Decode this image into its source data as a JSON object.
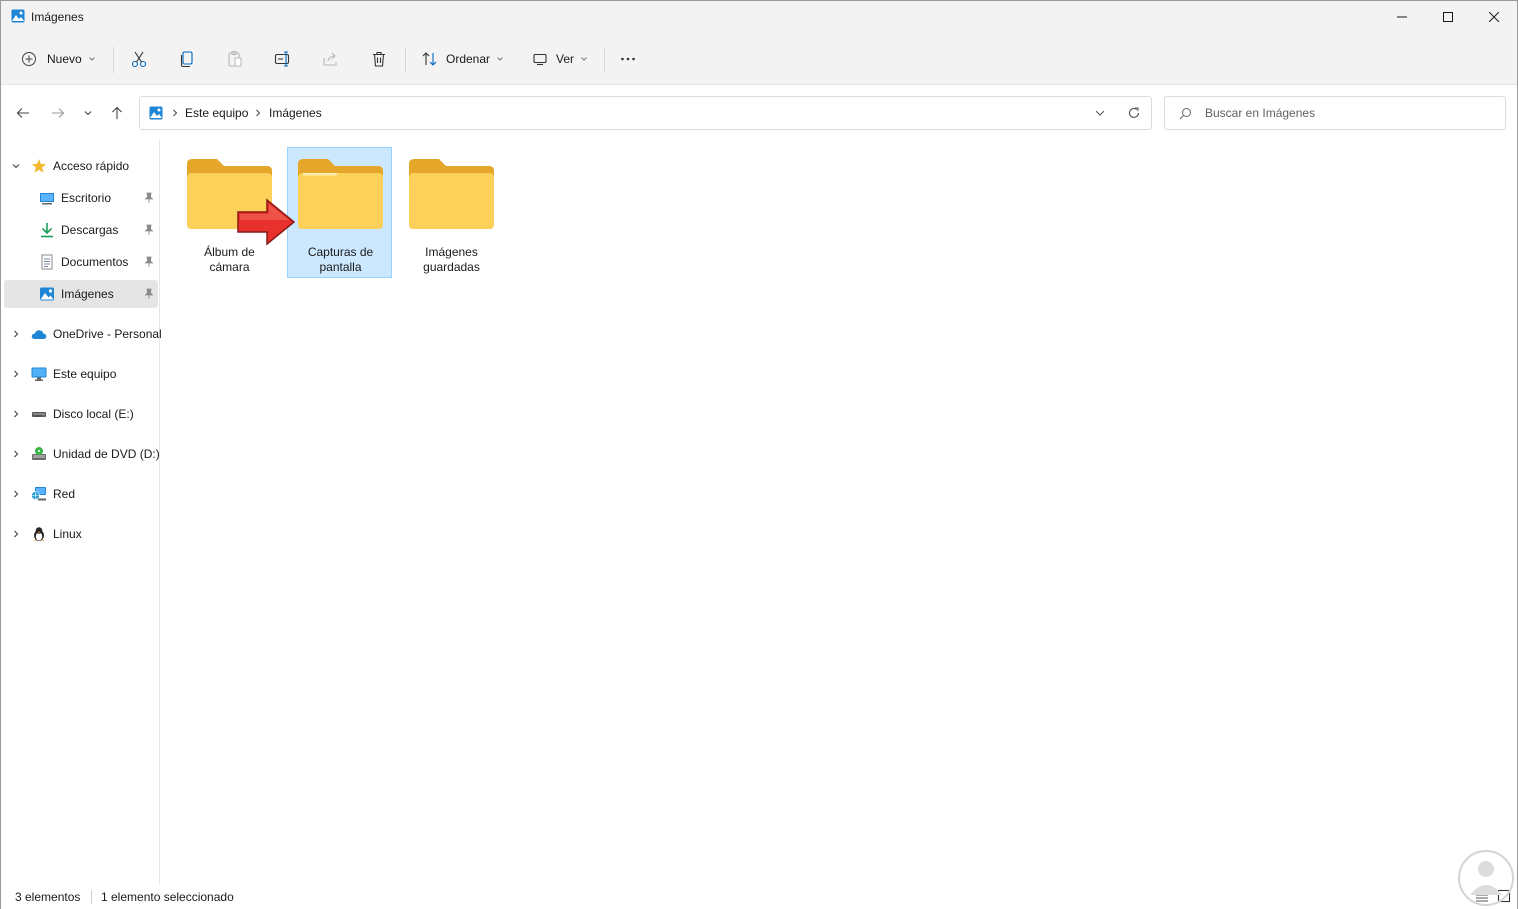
{
  "window": {
    "title": "Imágenes",
    "minimize_icon": "minimize-icon",
    "maximize_icon": "maximize-icon",
    "close_icon": "close-icon"
  },
  "toolbar": {
    "new_label": "Nuevo",
    "sort_label": "Ordenar",
    "view_label": "Ver",
    "icons": [
      "cut-icon",
      "copy-icon",
      "paste-icon",
      "rename-icon",
      "share-icon",
      "delete-icon",
      "more-icon"
    ]
  },
  "address": {
    "crumbs": [
      "Este equipo",
      "Imágenes"
    ],
    "search_placeholder": "Buscar en Imágenes"
  },
  "sidebar": {
    "items": [
      {
        "label": "Acceso rápido",
        "icon": "star-icon"
      },
      {
        "label": "Escritorio",
        "icon": "desktop-icon",
        "pinned": true
      },
      {
        "label": "Descargas",
        "icon": "download-icon",
        "pinned": true
      },
      {
        "label": "Documentos",
        "icon": "document-icon",
        "pinned": true
      },
      {
        "label": "Imágenes",
        "icon": "pictures-icon",
        "pinned": true,
        "active": true
      },
      {
        "label": "OneDrive - Personal",
        "icon": "cloud-icon"
      },
      {
        "label": "Este equipo",
        "icon": "computer-icon"
      },
      {
        "label": "Disco local (E:)",
        "icon": "drive-icon"
      },
      {
        "label": "Unidad de DVD (D:)",
        "icon": "dvd-icon"
      },
      {
        "label": "Red",
        "icon": "network-icon"
      },
      {
        "label": "Linux",
        "icon": "linux-icon"
      }
    ]
  },
  "folders": [
    {
      "line1": "Álbum de",
      "line2": "cámara",
      "selected": false
    },
    {
      "line1": "Capturas de",
      "line2": "pantalla",
      "selected": true
    },
    {
      "line1": "Imágenes",
      "line2": "guardadas",
      "selected": false
    }
  ],
  "status": {
    "count": "3 elementos",
    "selection": "1 elemento seleccionado"
  },
  "colors": {
    "chrome": "#f3f3f3",
    "selection": "#cce8ff",
    "selection_border": "#99d1ff",
    "folder": "#f8c83a",
    "arrow": "#e8302c",
    "accent": "#0067c0"
  }
}
